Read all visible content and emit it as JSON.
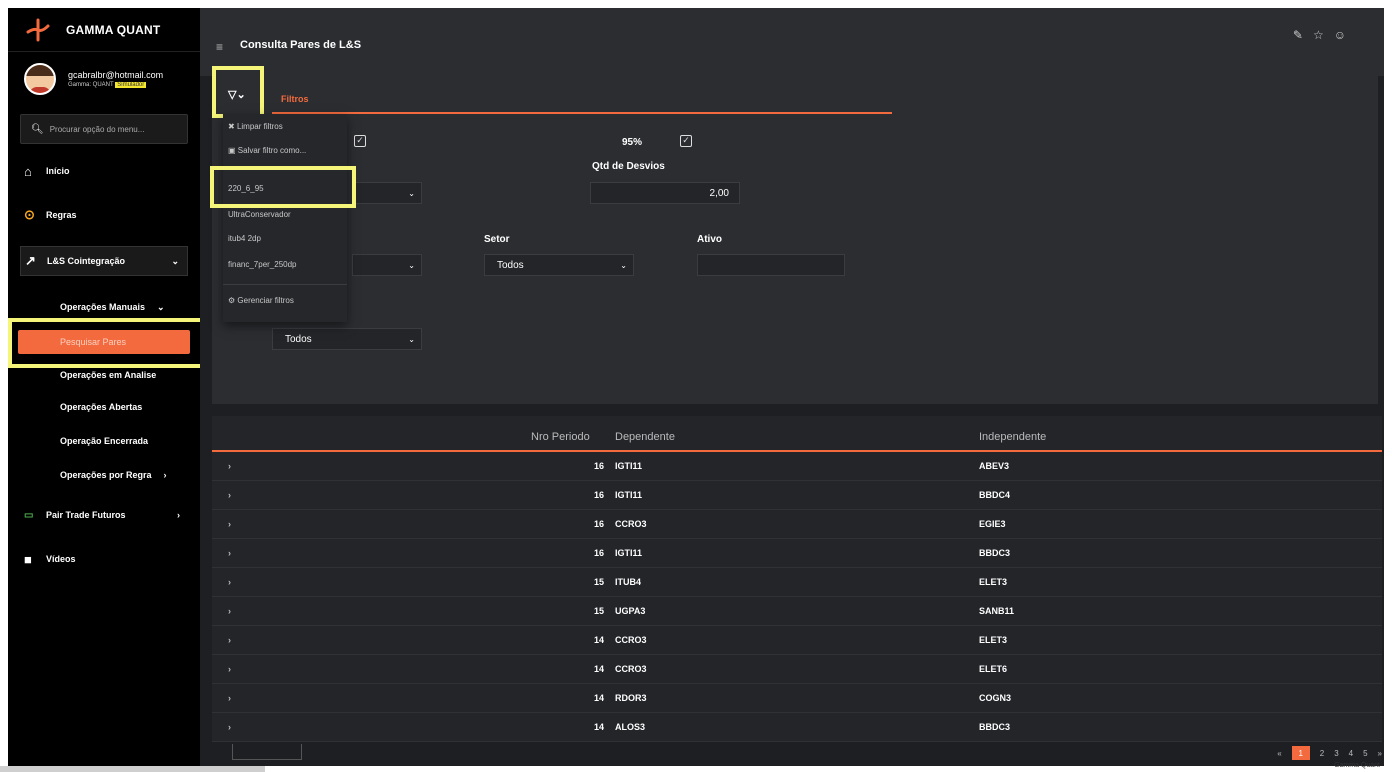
{
  "brand": {
    "name": "GAMMA QUANT"
  },
  "user": {
    "email": "gcabralbr@hotmail.com",
    "sub_prefix": "Gamma: QUANT",
    "sub_highlight": "Simulador"
  },
  "search": {
    "placeholder": "Procurar opção do menu..."
  },
  "nav": {
    "inicio": "Início",
    "regras": "Regras",
    "lbs": "L&S Cointegração",
    "operacoes_manuais": "Operações Manuais",
    "pesquisar_pares": "Pesquisar Pares",
    "em_analise": "Operações em Analise",
    "abertas": "Operações Abertas",
    "encerrada": "Operação Encerrada",
    "por_regra": "Operações por Regra",
    "pair_trade": "Pair Trade Futuros",
    "videos": "Vídeos"
  },
  "header": {
    "title": "Consulta Pares de L&S"
  },
  "filters": {
    "tab_label": "Filtros",
    "pct_label": "95%",
    "qtd_desvios_label": "Qtd de Desvios",
    "qtd_desvios_value": "2,00",
    "setor_label": "Setor",
    "setor_value": "Todos",
    "ativo_label": "Ativo",
    "ativo_value": "",
    "extra_select_value": "Todos"
  },
  "dropdown": {
    "limpar": "Limpar filtros",
    "salvar": "Salvar filtro como...",
    "saved": [
      "220_6_95",
      "UltraConservador",
      "itub4 2dp",
      "financ_7per_250dp"
    ],
    "gerenciar": "Gerenciar filtros"
  },
  "table": {
    "headers": {
      "nro": "Nro Periodo",
      "dep": "Dependente",
      "ind": "Independente"
    },
    "rows": [
      {
        "nro": "16",
        "dep": "IGTI11",
        "ind": "ABEV3"
      },
      {
        "nro": "16",
        "dep": "IGTI11",
        "ind": "BBDC4"
      },
      {
        "nro": "16",
        "dep": "CCRO3",
        "ind": "EGIE3"
      },
      {
        "nro": "16",
        "dep": "IGTI11",
        "ind": "BBDC3"
      },
      {
        "nro": "15",
        "dep": "ITUB4",
        "ind": "ELET3"
      },
      {
        "nro": "15",
        "dep": "UGPA3",
        "ind": "SANB11"
      },
      {
        "nro": "14",
        "dep": "CCRO3",
        "ind": "ELET3"
      },
      {
        "nro": "14",
        "dep": "CCRO3",
        "ind": "ELET6"
      },
      {
        "nro": "14",
        "dep": "RDOR3",
        "ind": "COGN3"
      },
      {
        "nro": "14",
        "dep": "ALOS3",
        "ind": "BBDC3"
      }
    ]
  },
  "pager": {
    "current": "1",
    "pages": [
      "2",
      "3",
      "4",
      "5"
    ]
  },
  "footer": {
    "text": "Gamma Quant"
  },
  "colors": {
    "accent": "#f26a3e",
    "highlight": "#f5f57a"
  }
}
